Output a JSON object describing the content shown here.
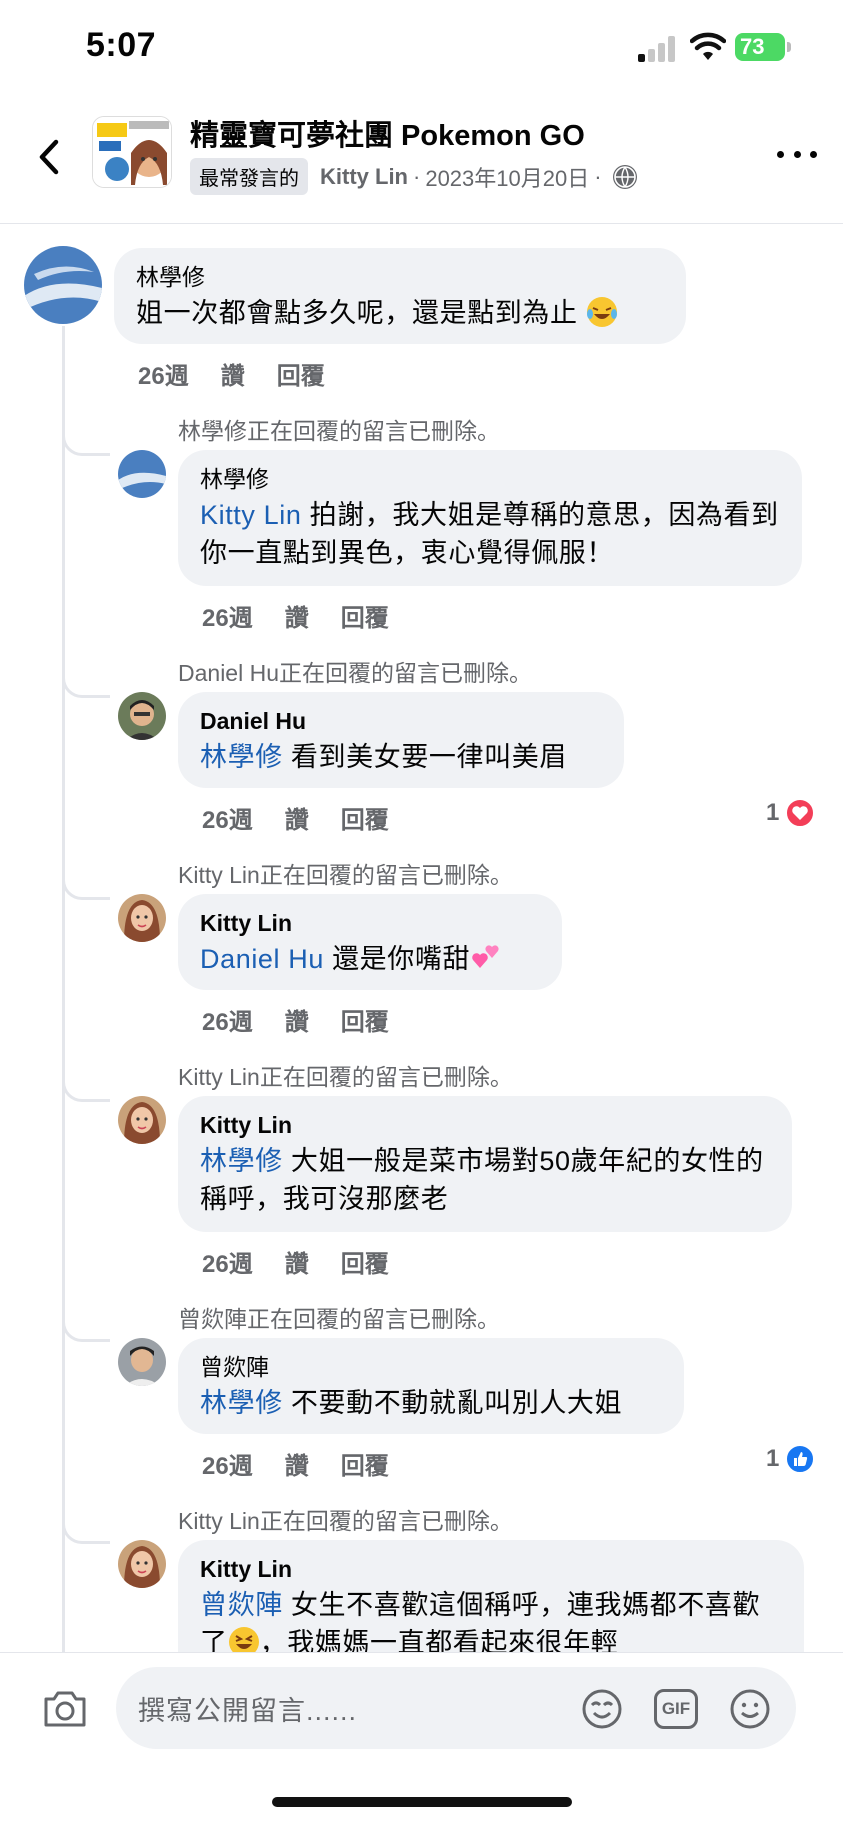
{
  "status_bar": {
    "time": "5:07",
    "battery": "73"
  },
  "header": {
    "group_title": "精靈寶可夢社團 Pokemon GO",
    "badge": "最常發言的",
    "author": "Kitty Lin",
    "date": "2023年10月20日",
    "separator": "·"
  },
  "comments": [
    {
      "author": "林學修",
      "text": "姐一次都會點多久呢，還是點到為止",
      "time": "26週",
      "like": "讚",
      "reply": "回覆"
    },
    {
      "deleted_note": "林學修正在回覆的留言已刪除。",
      "author": "林學修",
      "mention": "Kitty Lin",
      "text": "拍謝，我大姐是尊稱的意思，因為看到你一直點到異色，衷心覺得佩服！",
      "time": "26週",
      "like": "讚",
      "reply": "回覆"
    },
    {
      "deleted_note": "Daniel Hu正在回覆的留言已刪除。",
      "author": "Daniel Hu",
      "mention": "林學修",
      "text": "看到美女要一律叫美眉",
      "time": "26週",
      "like": "讚",
      "reply": "回覆",
      "reaction_count": "1",
      "reaction": "love"
    },
    {
      "deleted_note": "Kitty Lin正在回覆的留言已刪除。",
      "author": "Kitty Lin",
      "mention": "Daniel Hu",
      "text": "還是你嘴甜",
      "time": "26週",
      "like": "讚",
      "reply": "回覆"
    },
    {
      "deleted_note": "Kitty Lin正在回覆的留言已刪除。",
      "author": "Kitty Lin",
      "mention": "林學修",
      "text": "大姐一般是菜市場對50歲年紀的女性的稱呼，我可沒那麼老",
      "time": "26週",
      "like": "讚",
      "reply": "回覆"
    },
    {
      "deleted_note": "曾欻陣正在回覆的留言已刪除。",
      "author": "曾欻陣",
      "mention": "林學修",
      "text": "不要動不動就亂叫別人大姐",
      "time": "26週",
      "like": "讚",
      "reply": "回覆",
      "reaction_count": "1",
      "reaction": "like"
    },
    {
      "deleted_note": "Kitty Lin正在回覆的留言已刪除。",
      "author": "Kitty Lin",
      "mention": "曾欻陣",
      "text_line1": "女生不喜歡這個稱呼，連我媽都不喜",
      "text_line2a": "歡了",
      "text_line2b": "，我媽媽一直都看起來很年輕"
    }
  ],
  "composer": {
    "placeholder": "撰寫公開留言......",
    "gif_label": "GIF"
  },
  "colors": {
    "mention": "#1b5fb3",
    "bubble": "#f0f2f5",
    "love": "#f33e58",
    "like": "#1877f2",
    "battery": "#4cd964"
  }
}
